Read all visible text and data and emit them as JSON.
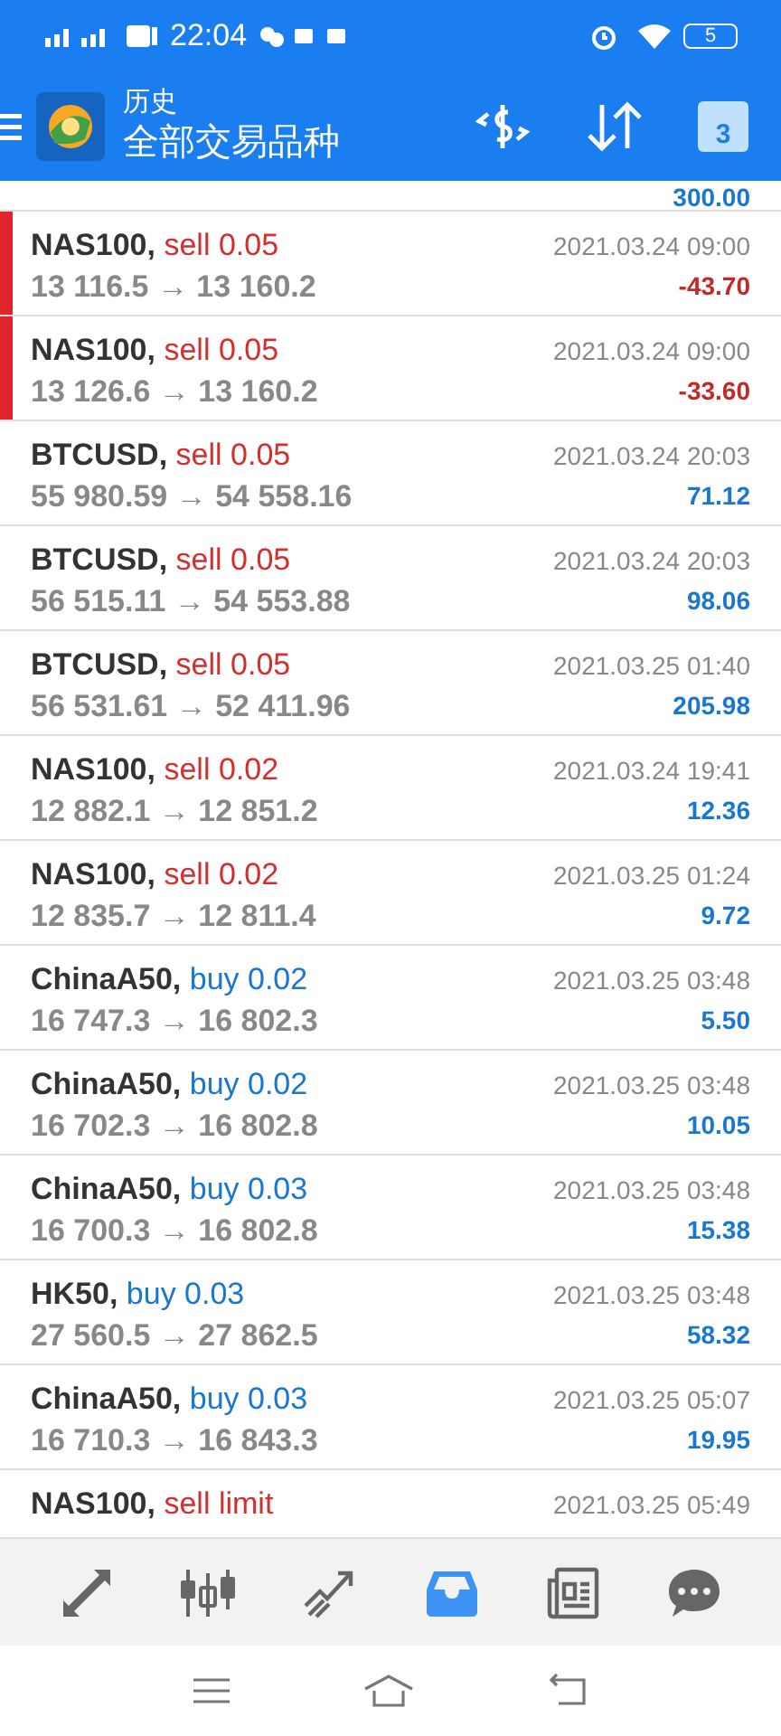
{
  "status_bar": {
    "time": "22:04",
    "battery": "5"
  },
  "app_bar": {
    "subtitle": "历史",
    "title": "全部交易品种",
    "calendar_day": "3"
  },
  "partial_row": {
    "profit": "300.00"
  },
  "deals": [
    {
      "symbol": "NAS100,",
      "action": "sell 0.05",
      "color": "#d32f2f",
      "prices": "13 116.5 → 13 160.2",
      "time": "2021.03.24 09:00",
      "profit": "-43.70",
      "loss": true,
      "flagged": true
    },
    {
      "symbol": "NAS100,",
      "action": "sell 0.05",
      "color": "#d32f2f",
      "prices": "13 126.6 → 13 160.2",
      "time": "2021.03.24 09:00",
      "profit": "-33.60",
      "loss": true,
      "flagged": true
    },
    {
      "symbol": "BTCUSD,",
      "action": "sell 0.05",
      "color": "#d32f2f",
      "prices": "55 980.59 → 54 558.16",
      "time": "2021.03.24 20:03",
      "profit": "71.12",
      "loss": false,
      "flagged": false
    },
    {
      "symbol": "BTCUSD,",
      "action": "sell 0.05",
      "color": "#d32f2f",
      "prices": "56 515.11 → 54 553.88",
      "time": "2021.03.24 20:03",
      "profit": "98.06",
      "loss": false,
      "flagged": false
    },
    {
      "symbol": "BTCUSD,",
      "action": "sell 0.05",
      "color": "#d32f2f",
      "prices": "56 531.61 → 52 411.96",
      "time": "2021.03.25 01:40",
      "profit": "205.98",
      "loss": false,
      "flagged": false
    },
    {
      "symbol": "NAS100,",
      "action": "sell 0.02",
      "color": "#d32f2f",
      "prices": "12 882.1 → 12 851.2",
      "time": "2021.03.24 19:41",
      "profit": "12.36",
      "loss": false,
      "flagged": false
    },
    {
      "symbol": "NAS100,",
      "action": "sell 0.02",
      "color": "#d32f2f",
      "prices": "12 835.7 → 12 811.4",
      "time": "2021.03.25 01:24",
      "profit": "9.72",
      "loss": false,
      "flagged": false
    },
    {
      "symbol": "ChinaA50,",
      "action": "buy 0.02",
      "color": "#1976d2",
      "prices": "16 747.3 → 16 802.3",
      "time": "2021.03.25 03:48",
      "profit": "5.50",
      "loss": false,
      "flagged": false
    },
    {
      "symbol": "ChinaA50,",
      "action": "buy 0.02",
      "color": "#1976d2",
      "prices": "16 702.3 → 16 802.8",
      "time": "2021.03.25 03:48",
      "profit": "10.05",
      "loss": false,
      "flagged": false
    },
    {
      "symbol": "ChinaA50,",
      "action": "buy 0.03",
      "color": "#1976d2",
      "prices": "16 700.3 → 16 802.8",
      "time": "2021.03.25 03:48",
      "profit": "15.38",
      "loss": false,
      "flagged": false
    },
    {
      "symbol": "HK50,",
      "action": "buy 0.03",
      "color": "#1976d2",
      "prices": "27 560.5 → 27 862.5",
      "time": "2021.03.25 03:48",
      "profit": "58.32",
      "loss": false,
      "flagged": false
    },
    {
      "symbol": "ChinaA50,",
      "action": "buy 0.03",
      "color": "#1976d2",
      "prices": "16 710.3 → 16 843.3",
      "time": "2021.03.25 05:07",
      "profit": "19.95",
      "loss": false,
      "flagged": false
    },
    {
      "symbol": "NAS100,",
      "action": "sell limit",
      "color": "#d32f2f",
      "time": "2021.03.25 05:49",
      "flagged": false
    }
  ],
  "bottom_nav": [
    {
      "kind": "quotes",
      "selected": false
    },
    {
      "kind": "chart",
      "selected": false
    },
    {
      "kind": "trade",
      "selected": false
    },
    {
      "kind": "history",
      "selected": true
    },
    {
      "kind": "news",
      "selected": false
    },
    {
      "kind": "chat",
      "selected": false
    }
  ]
}
